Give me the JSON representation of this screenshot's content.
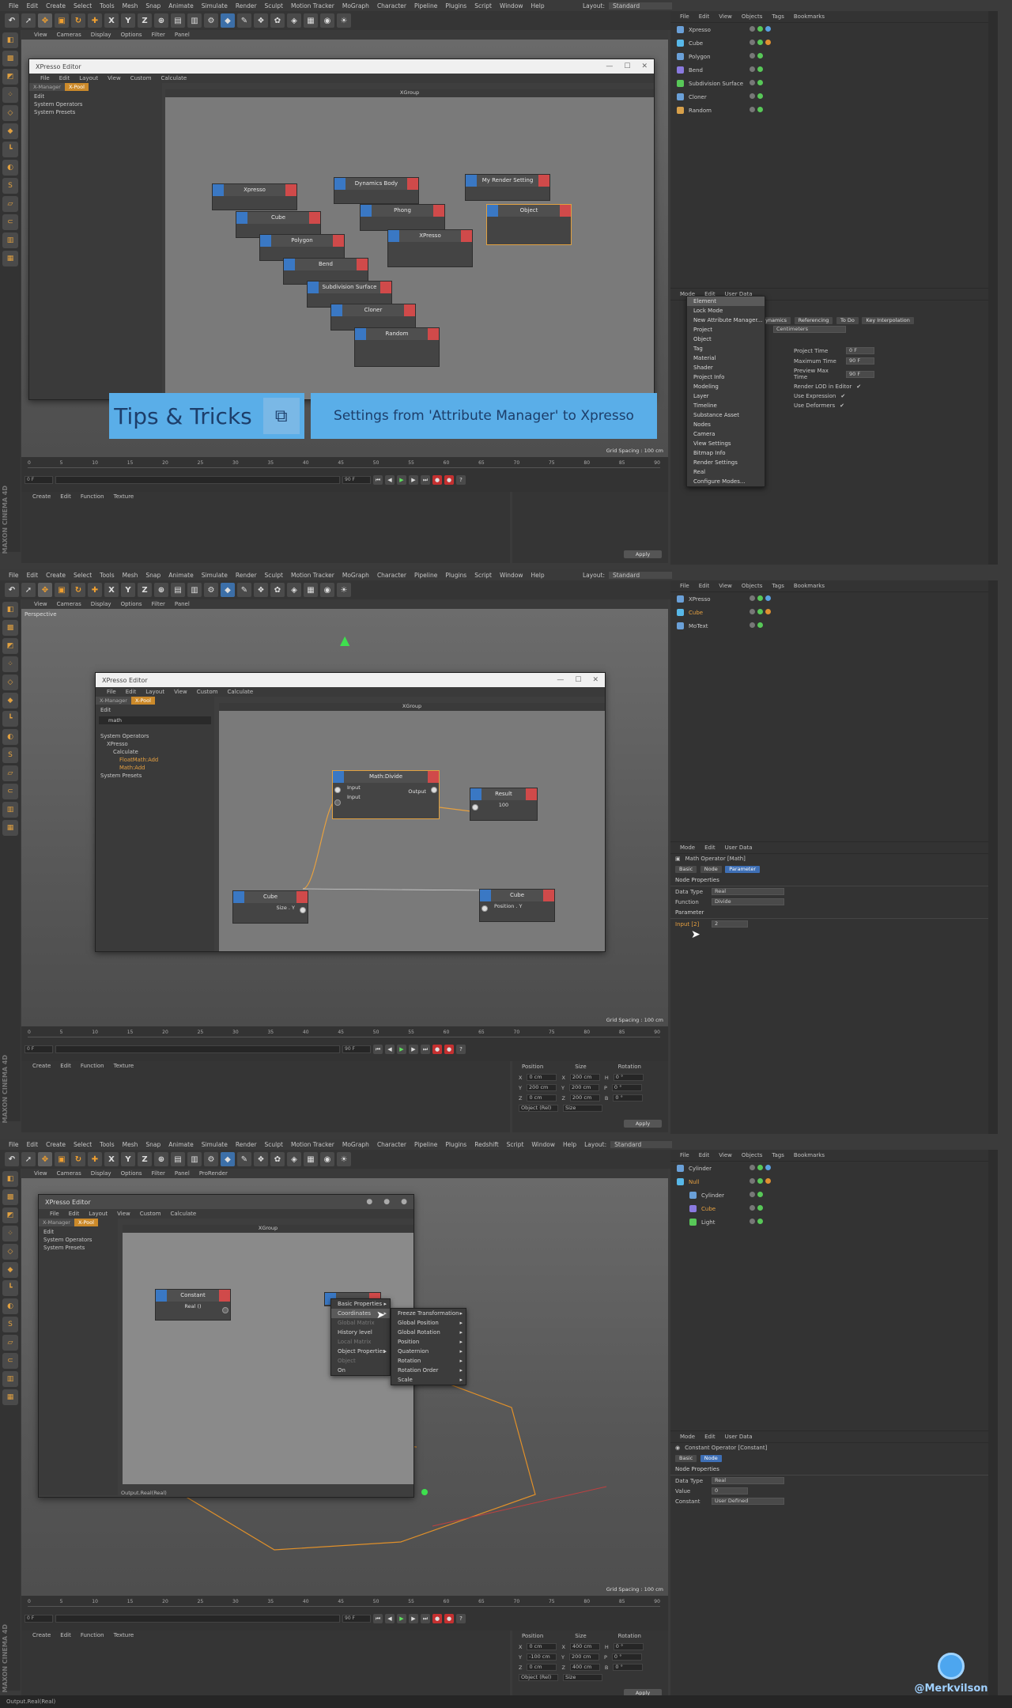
{
  "menubar": [
    "File",
    "Edit",
    "Create",
    "Select",
    "Tools",
    "Mesh",
    "Snap",
    "Animate",
    "Simulate",
    "Render",
    "Sculpt",
    "Motion Tracker",
    "MoGraph",
    "Character",
    "Pipeline",
    "Plugins",
    "Script",
    "Window",
    "Help"
  ],
  "menubar3": [
    "File",
    "Edit",
    "Create",
    "Select",
    "Tools",
    "Mesh",
    "Snap",
    "Animate",
    "Simulate",
    "Render",
    "Sculpt",
    "Motion Tracker",
    "MoGraph",
    "Character",
    "Pipeline",
    "Plugins",
    "Redshift",
    "Script",
    "Window",
    "Help"
  ],
  "layout_label": "Layout:",
  "layout_value": "Standard",
  "toolbar": {
    "x": "X",
    "y": "Y",
    "z": "Z"
  },
  "vp_menu": [
    "View",
    "Cameras",
    "Display",
    "Options",
    "Filter",
    "Panel"
  ],
  "vp_menu3": [
    "View",
    "Cameras",
    "Display",
    "Options",
    "Filter",
    "Panel",
    "ProRender"
  ],
  "perspective": "Perspective",
  "grid_spacing": "Grid Spacing : 100 cm",
  "ruler": [
    "0",
    "5",
    "10",
    "15",
    "20",
    "25",
    "30",
    "35",
    "40",
    "45",
    "50",
    "55",
    "60",
    "65",
    "70",
    "75",
    "80",
    "85",
    "90"
  ],
  "frame_start": "0 F",
  "frame_end": "90 F",
  "mat_menu": [
    "Create",
    "Edit",
    "Function",
    "Texture"
  ],
  "coords": {
    "position": "Position",
    "size": "Size",
    "rotation": "Rotation",
    "apply": "Apply",
    "object_rel": "Object (Rel)",
    "size_mode": "Size",
    "s2_rows": [
      [
        "X",
        "0 cm",
        "X",
        "200 cm",
        "H",
        "0 °"
      ],
      [
        "Y",
        "200 cm",
        "Y",
        "200 cm",
        "P",
        "0 °"
      ],
      [
        "Z",
        "0 cm",
        "Z",
        "200 cm",
        "B",
        "0 °"
      ]
    ],
    "s3_rows": [
      [
        "X",
        "0 cm",
        "X",
        "400 cm",
        "H",
        "0 °"
      ],
      [
        "Y",
        "-100 cm",
        "Y",
        "200 cm",
        "P",
        "0 °"
      ],
      [
        "Z",
        "0 cm",
        "Z",
        "400 cm",
        "B",
        "0 °"
      ]
    ]
  },
  "obj_menu": [
    "File",
    "Edit",
    "View",
    "Objects",
    "Tags",
    "Bookmarks"
  ],
  "screen1": {
    "objects": [
      "Xpresso",
      "Cube",
      "Polygon",
      "Bend",
      "Subdivision Surface",
      "Cloner",
      "Random"
    ],
    "xpresso_title": "XPresso Editor",
    "xmenu": [
      "File",
      "Edit",
      "Layout",
      "View",
      "Custom",
      "Calculate"
    ],
    "xtabs": [
      "X-Manager",
      "X-Pool"
    ],
    "xedit": "Edit",
    "tree": [
      "System Operators",
      "System Presets"
    ],
    "xgroup": "XGroup",
    "nodes": [
      "Xpresso",
      "Cube",
      "Polygon",
      "Bend",
      "Subdivision Surface",
      "Cloner",
      "Random",
      "Dynamics Body",
      "Phong",
      "XPresso",
      "My Render Setting",
      "Object"
    ],
    "banner_left": "Tips & Tricks",
    "banner_right": "Settings from 'Attribute Manager' to Xpresso",
    "attr_menu": [
      "Mode",
      "Edit",
      "User Data"
    ],
    "mode_menu": [
      "Element",
      "Lock Mode",
      "New Attribute Manager...",
      "Project",
      "Object",
      "Tag",
      "Material",
      "Shader",
      "Project Info",
      "Modeling",
      "Layer",
      "Timeline",
      "Substance Asset",
      "Nodes",
      "Camera",
      "View Settings",
      "Bitmap Info",
      "Render Settings",
      "Real",
      "Configure Modes..."
    ],
    "attr_tabs": [
      "Dynamics",
      "Referencing",
      "To Do",
      "Key Interpolation"
    ],
    "attr_fields": [
      [
        "Project Time",
        "0 F"
      ],
      [
        "Maximum Time",
        "90 F"
      ],
      [
        "Preview Max Time",
        "90 F"
      ]
    ],
    "attr_checks": [
      "Render LOD in Editor",
      "Use Expression",
      "Use Deformers"
    ],
    "attr_drop": "Centimeters"
  },
  "screen2": {
    "objects": [
      "XPresso",
      "Cube",
      "MoText"
    ],
    "xpresso_title": "XPresso Editor",
    "search": "math",
    "tree": [
      "System Operators",
      "XPresso",
      "Calculate",
      "FloatMath:Add",
      "Math:Add",
      "System Presets"
    ],
    "xgroup": "XGroup",
    "node_math": "Math:Divide",
    "port_input1": "Input",
    "port_input2": "Input",
    "port_output": "Output",
    "node_result": "Result",
    "result_value": "100",
    "node_cube1": "Cube",
    "port_size": "Size . Y",
    "node_cube2": "Cube",
    "port_position": "Position . Y",
    "attr_menu": [
      "Mode",
      "Edit",
      "User Data"
    ],
    "attr_title": "Math Operator [Math]",
    "attr_tabs": [
      "Basic",
      "Node",
      "Parameter"
    ],
    "node_props": "Node Properties",
    "data_type_label": "Data Type",
    "data_type": "Real",
    "function_label": "Function",
    "function": "Divide",
    "parameter": "Parameter",
    "input_label": "Input [2]",
    "input_value": "2"
  },
  "screen3": {
    "objects": [
      "Cylinder",
      "Null",
      "Cylinder",
      "Cube",
      "Light"
    ],
    "xpresso_title": "XPresso Editor",
    "tree": [
      "System Operators",
      "System Presets"
    ],
    "xgroup": "XGroup",
    "node_const": "Constant",
    "port_real": "Real ()",
    "ctx1": [
      "Basic Properties",
      "Coordinates",
      "Global Matrix",
      "History level",
      "Local Matrix",
      "Object Properties",
      "Object",
      "On"
    ],
    "ctx2": [
      "Freeze Transformation",
      "Global Position",
      "Global Rotation",
      "Position",
      "Quaternion",
      "Rotation",
      "Rotation Order",
      "Scale"
    ],
    "output_label": "Output.Real(Real)",
    "attr_menu": [
      "Mode",
      "Edit",
      "User Data"
    ],
    "attr_title": "Constant Operator [Constant]",
    "attr_tabs": [
      "Basic",
      "Node"
    ],
    "node_props": "Node Properties",
    "data_type_label": "Data Type",
    "data_type": "Real",
    "value_label": "Value",
    "value": "0",
    "constant_label": "Constant",
    "constant": "User Defined"
  },
  "maxon": "MAXON CINEMA 4D",
  "watermark": "@Merkvilson",
  "status": "Output.Real(Real)"
}
